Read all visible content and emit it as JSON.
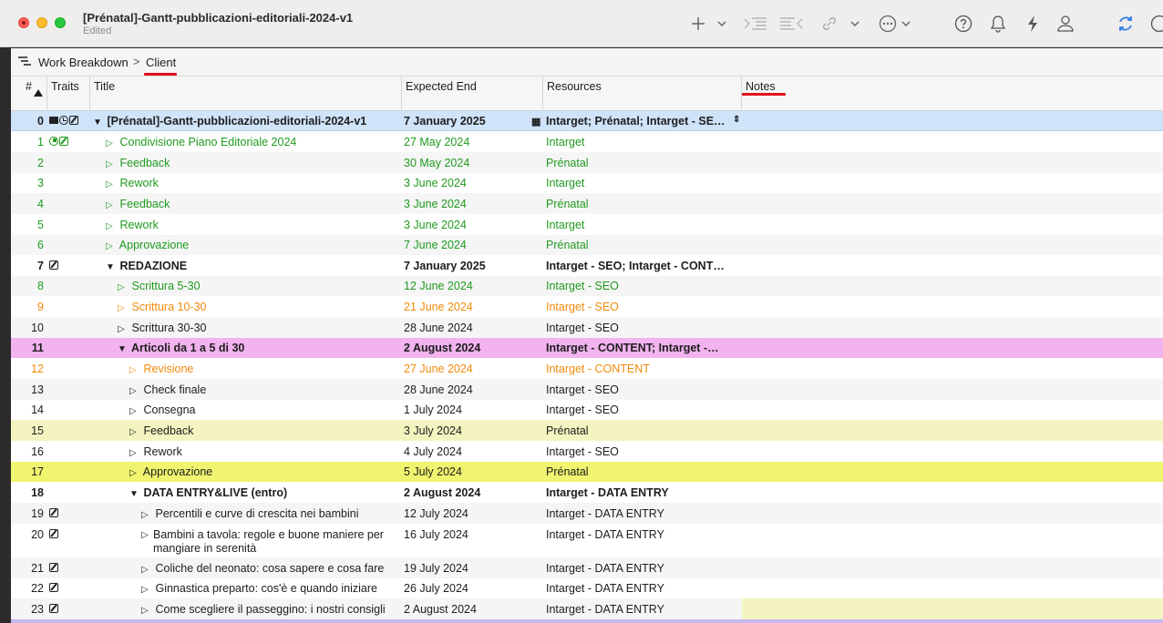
{
  "window": {
    "title": "[Prénatal]-Gantt-pubblicazioni-editoriali-2024-v1",
    "status": "Edited"
  },
  "toolbar": {
    "icons": [
      "plus-icon",
      "chevron-down-icon",
      "indent-icon",
      "outdent-icon",
      "link-icon",
      "chevron-down-icon",
      "more-icon",
      "chevron-down-icon",
      "help-icon",
      "bell-icon",
      "lightning-icon",
      "person-icon",
      "sync-icon"
    ]
  },
  "breadcrumb": {
    "root": "Work Breakdown",
    "current": "Client"
  },
  "columns": {
    "num": "#",
    "traits": "Traits",
    "title": "Title",
    "expected_end": "Expected End",
    "resources": "Resources",
    "notes": "Notes"
  },
  "colors": {
    "selected_row": "#cfe3f9",
    "pink_row": "#f2b3ef",
    "light_yellow_row": "#f3f4bf",
    "yellow_row": "#f0f46f",
    "green_text": "#1f9a1f",
    "orange_text": "#f28a0b",
    "annotation_red": "#e0101a"
  },
  "rows": [
    {
      "num": "0",
      "title": "[Prénatal]-Gantt-pubblicazioni-editoriali-2024-v1",
      "end": "7 January 2025",
      "res": "Intarget; Prénatal; Intarget - SE…"
    },
    {
      "num": "1",
      "title": "Condivisione Piano Editoriale 2024",
      "end": "27 May 2024",
      "res": "Intarget"
    },
    {
      "num": "2",
      "title": "Feedback",
      "end": "30 May 2024",
      "res": "Prénatal"
    },
    {
      "num": "3",
      "title": "Rework",
      "end": "3 June 2024",
      "res": "Intarget"
    },
    {
      "num": "4",
      "title": "Feedback",
      "end": "3 June 2024",
      "res": "Prénatal"
    },
    {
      "num": "5",
      "title": "Rework",
      "end": "3 June 2024",
      "res": "Intarget"
    },
    {
      "num": "6",
      "title": "Approvazione",
      "end": "7 June 2024",
      "res": "Prénatal"
    },
    {
      "num": "7",
      "title": "REDAZIONE",
      "end": "7 January 2025",
      "res": "Intarget - SEO; Intarget - CONT…"
    },
    {
      "num": "8",
      "title": "Scrittura 5-30",
      "end": "12 June 2024",
      "res": "Intarget - SEO"
    },
    {
      "num": "9",
      "title": "Scrittura 10-30",
      "end": "21 June 2024",
      "res": "Intarget - SEO"
    },
    {
      "num": "10",
      "title": "Scrittura 30-30",
      "end": "28 June 2024",
      "res": "Intarget - SEO"
    },
    {
      "num": "11",
      "title": "Articoli da 1 a 5 di 30",
      "end": "2 August 2024",
      "res": "Intarget - CONTENT; Intarget -…"
    },
    {
      "num": "12",
      "title": "Revisione",
      "end": "27 June 2024",
      "res": "Intarget - CONTENT"
    },
    {
      "num": "13",
      "title": "Check finale",
      "end": "28 June 2024",
      "res": "Intarget - SEO"
    },
    {
      "num": "14",
      "title": "Consegna",
      "end": "1 July 2024",
      "res": "Intarget - SEO"
    },
    {
      "num": "15",
      "title": "Feedback",
      "end": "3 July 2024",
      "res": "Prénatal"
    },
    {
      "num": "16",
      "title": "Rework",
      "end": "4 July 2024",
      "res": "Intarget - SEO"
    },
    {
      "num": "17",
      "title": "Approvazione",
      "end": "5 July 2024",
      "res": "Prénatal"
    },
    {
      "num": "18",
      "title": "DATA ENTRY&LIVE (entro)",
      "end": "2 August 2024",
      "res": "Intarget - DATA ENTRY"
    },
    {
      "num": "19",
      "title": "Percentili e curve di crescita nei bambini",
      "end": "12 July 2024",
      "res": "Intarget - DATA ENTRY"
    },
    {
      "num": "20",
      "title": "Bambini a tavola: regole e buone maniere per mangiare in serenità",
      "end": "16 July 2024",
      "res": "Intarget - DATA ENTRY"
    },
    {
      "num": "21",
      "title": "Coliche del neonato: cosa sapere e cosa fare",
      "end": "19 July 2024",
      "res": "Intarget - DATA ENTRY"
    },
    {
      "num": "22",
      "title": "Ginnastica preparto: cos'è e quando iniziare",
      "end": "26 July 2024",
      "res": "Intarget - DATA ENTRY"
    },
    {
      "num": "23",
      "title": "Come scegliere il passeggino: i nostri consigli",
      "end": "2 August 2024",
      "res": "Intarget - DATA ENTRY"
    }
  ]
}
